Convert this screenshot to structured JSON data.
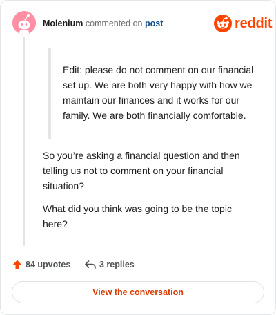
{
  "comment": {
    "username": "Molenium",
    "action_text": "commented on",
    "link_text": "post",
    "quote": "Edit: please do not comment on our financial set up. We are both very happy with how we maintain our finances and it works for our family. We are both financially comfortable.",
    "paragraphs": [
      "So you’re asking a financial question and then telling us not to comment on your financial situation?",
      "What did you think was going to be the topic here?"
    ]
  },
  "brand": {
    "name": "reddit",
    "color": "#ff4500"
  },
  "stats": {
    "upvotes": "84 upvotes",
    "replies": "3 replies"
  },
  "cta": {
    "label": "View the conversation"
  },
  "icons": [
    "avatar-snoo",
    "reddit-logo-icon",
    "upvote-arrow-icon",
    "reply-arrow-icon"
  ]
}
